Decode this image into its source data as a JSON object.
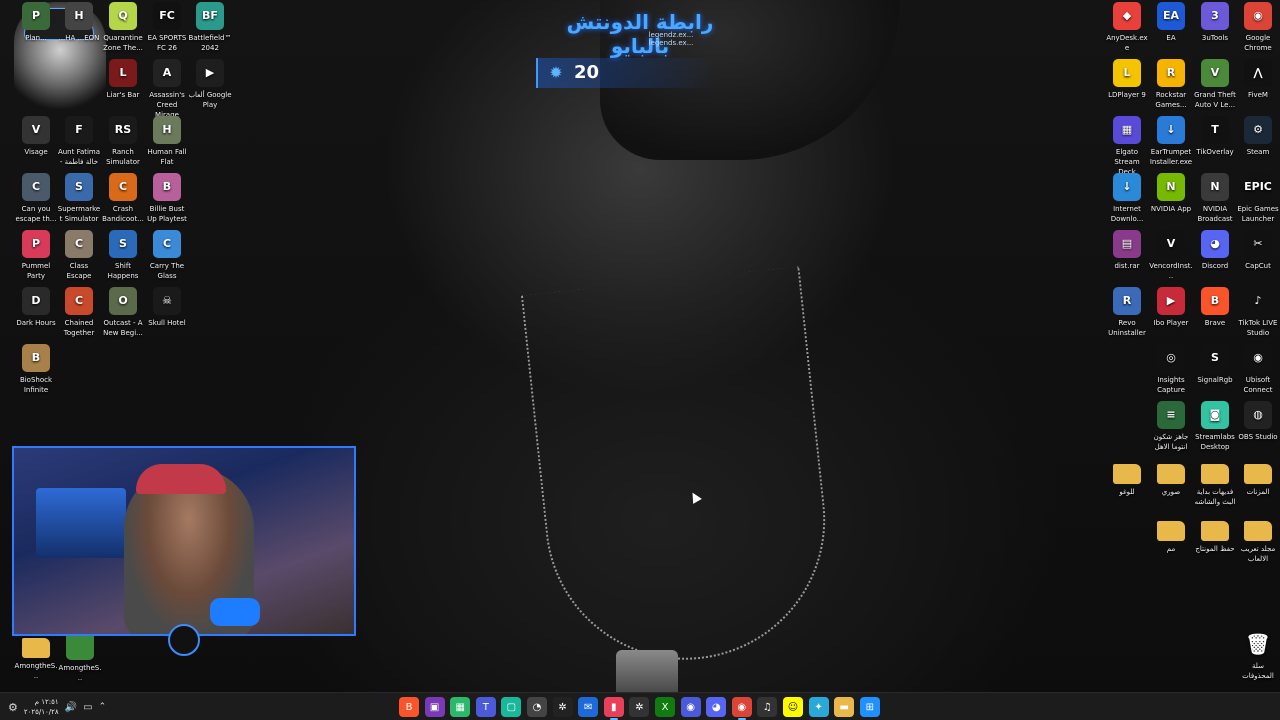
{
  "overlay": {
    "title": "رابطة الدونتش بالبايو",
    "subtitle": "legendz.ex... legends.ex...",
    "counter": "20",
    "counter_icon": "flame-icon"
  },
  "desktop_left": [
    {
      "label": "Plan...",
      "icon": "game-icon",
      "color": "#3a6a3a",
      "glyph": "P"
    },
    {
      "label": "...HA ...EON",
      "icon": "game-icon",
      "color": "#444",
      "glyph": "H"
    },
    {
      "label": "Quarantine Zone The...",
      "icon": "game-icon",
      "color": "#b6d64a",
      "glyph": "Q"
    },
    {
      "label": "EA SPORTS FC 26",
      "icon": "game-icon",
      "color": "#111",
      "glyph": "FC"
    },
    {
      "label": "Battlefield™ 2042",
      "icon": "game-icon",
      "color": "#2a9a8a",
      "glyph": "BF"
    },
    {
      "label": "Liar's Bar",
      "icon": "game-icon",
      "color": "#7a1a1a",
      "glyph": "L"
    },
    {
      "label": "Assassin's Creed Mirage",
      "icon": "game-icon",
      "color": "#222",
      "glyph": "A"
    },
    {
      "label": "ألعاب Google Play",
      "icon": "google-play-icon",
      "color": "#1e1e1e",
      "glyph": "▶"
    },
    {
      "label": "Visage",
      "icon": "game-icon",
      "color": "#333",
      "glyph": "V"
    },
    {
      "label": "Aunt Fatima - خالة فاطمة",
      "icon": "game-icon",
      "color": "#1a1a1a",
      "glyph": "F"
    },
    {
      "label": "Ranch Simulator",
      "icon": "game-icon",
      "color": "#1a1a1a",
      "glyph": "RS"
    },
    {
      "label": "Human Fall Flat",
      "icon": "game-icon",
      "color": "#6a7a5a",
      "glyph": "H"
    },
    {
      "label": "Can you escape th...",
      "icon": "game-icon",
      "color": "#4a5a6a",
      "glyph": "C"
    },
    {
      "label": "Supermarket Simulator",
      "icon": "game-icon",
      "color": "#3a6aaa",
      "glyph": "S"
    },
    {
      "label": "Crash Bandicoot...",
      "icon": "game-icon",
      "color": "#d86a1a",
      "glyph": "C"
    },
    {
      "label": "Billie Bust Up Playtest",
      "icon": "game-icon",
      "color": "#b8609a",
      "glyph": "B"
    },
    {
      "label": "Pummel Party",
      "icon": "game-icon",
      "color": "#d83a5a",
      "glyph": "P"
    },
    {
      "label": "Class Escape",
      "icon": "game-icon",
      "color": "#8a7a6a",
      "glyph": "C"
    },
    {
      "label": "Shift Happens",
      "icon": "game-icon",
      "color": "#2a6ab8",
      "glyph": "S"
    },
    {
      "label": "Carry The Glass",
      "icon": "game-icon",
      "color": "#3a8ad8",
      "glyph": "C"
    },
    {
      "label": "Dark Hours",
      "icon": "game-icon",
      "color": "#2a2a2a",
      "glyph": "D"
    },
    {
      "label": "Chained Together",
      "icon": "game-icon",
      "color": "#c84a2a",
      "glyph": "C"
    },
    {
      "label": "Outcast - A New Begi...",
      "icon": "game-icon",
      "color": "#5a6a4a",
      "glyph": "O"
    },
    {
      "label": "Skull Hotel",
      "icon": "game-icon",
      "color": "#1a1a1a",
      "glyph": "☠"
    },
    {
      "label": "BioShock Infinite",
      "icon": "game-icon",
      "color": "#a8804a",
      "glyph": "B"
    }
  ],
  "desktop_right": [
    {
      "label": "AnyDesk.exe",
      "icon": "anydesk-icon",
      "color": "#e8403a",
      "glyph": "◆"
    },
    {
      "label": "EA",
      "icon": "ea-icon",
      "color": "#1e5ad8",
      "glyph": "EA"
    },
    {
      "label": "3uTools",
      "icon": "3utools-icon",
      "color": "#6a5ad8",
      "glyph": "3"
    },
    {
      "label": "Google Chrome",
      "icon": "chrome-icon",
      "color": "#db4437",
      "glyph": "◉"
    },
    {
      "label": "LDPlayer 9",
      "icon": "ldplayer-icon",
      "color": "#f4c400",
      "glyph": "L"
    },
    {
      "label": "Rockstar Games...",
      "icon": "rockstar-icon",
      "color": "#f4b400",
      "glyph": "R"
    },
    {
      "label": "Grand Theft Auto V Le...",
      "icon": "gta-icon",
      "color": "#4a8a3a",
      "glyph": "V"
    },
    {
      "label": "FiveM",
      "icon": "fivem-icon",
      "color": "#111",
      "glyph": "⋀"
    },
    {
      "label": "Elgato Stream Deck",
      "icon": "streamdeck-icon",
      "color": "#5a4ad8",
      "glyph": "▦"
    },
    {
      "label": "EarTrumpet Installer.exe",
      "icon": "installer-icon",
      "color": "#2a7ad8",
      "glyph": "↓"
    },
    {
      "label": "TikOverlay",
      "icon": "tikoverlay-icon",
      "color": "#111",
      "glyph": "T"
    },
    {
      "label": "Steam",
      "icon": "steam-icon",
      "color": "#1b2838",
      "glyph": "⚙"
    },
    {
      "label": "Internet Downlo...",
      "icon": "idm-icon",
      "color": "#2a8ad8",
      "glyph": "↓"
    },
    {
      "label": "NVIDIA App",
      "icon": "nvidia-icon",
      "color": "#76b900",
      "glyph": "N"
    },
    {
      "label": "NVIDIA Broadcast",
      "icon": "nvidia-broadcast-icon",
      "color": "#3a3a3a",
      "glyph": "N"
    },
    {
      "label": "Epic Games Launcher",
      "icon": "epic-icon",
      "color": "#111",
      "glyph": "EPIC"
    },
    {
      "label": "dist.rar",
      "icon": "winrar-icon",
      "color": "#8a3a8a",
      "glyph": "▤"
    },
    {
      "label": "VencordInst...",
      "icon": "vencord-icon",
      "color": "#111",
      "glyph": "V"
    },
    {
      "label": "Discord",
      "icon": "discord-icon",
      "color": "#5865f2",
      "glyph": "◕"
    },
    {
      "label": "CapCut",
      "icon": "capcut-icon",
      "color": "#111",
      "glyph": "✂"
    },
    {
      "label": "Revo Uninstaller",
      "icon": "revo-icon",
      "color": "#3a6ab8",
      "glyph": "R"
    },
    {
      "label": "Ibo Player",
      "icon": "iboplayer-icon",
      "color": "#c82a3a",
      "glyph": "▶"
    },
    {
      "label": "Brave",
      "icon": "brave-icon",
      "color": "#fb542b",
      "glyph": "B"
    },
    {
      "label": "TikTok LIVE Studio",
      "icon": "tiktok-icon",
      "color": "#111",
      "glyph": "♪"
    },
    {
      "label": "Insights Capture",
      "icon": "insights-icon",
      "color": "#111",
      "glyph": "◎"
    },
    {
      "label": "SignalRgb",
      "icon": "signalrgb-icon",
      "color": "#111",
      "glyph": "S"
    },
    {
      "label": "Ubisoft Connect",
      "icon": "ubisoft-icon",
      "color": "#111",
      "glyph": "◉"
    },
    {
      "label": "جاهز شكون انتوما الاهل",
      "icon": "file-icon",
      "color": "#2a6a3a",
      "glyph": "≡"
    },
    {
      "label": "Streamlabs Desktop",
      "icon": "streamlabs-icon",
      "color": "#31c3a2",
      "glyph": "◙"
    },
    {
      "label": "OBS Studio",
      "icon": "obs-icon",
      "color": "#222",
      "glyph": "◍"
    },
    {
      "label": "للوغو",
      "icon": "folder-icon",
      "color": "#e8b84a",
      "glyph": ""
    },
    {
      "label": "صوري",
      "icon": "folder-icon",
      "color": "#e8b84a",
      "glyph": ""
    },
    {
      "label": "فديهات بداية البث والشاشه",
      "icon": "folder-icon",
      "color": "#e8b84a",
      "glyph": ""
    },
    {
      "label": "المزنات",
      "icon": "folder-icon",
      "color": "#e8b84a",
      "glyph": ""
    },
    {
      "label": "مم",
      "icon": "folder-icon",
      "color": "#e8b84a",
      "glyph": ""
    },
    {
      "label": "حفظ المونتاج",
      "icon": "folder-icon",
      "color": "#e8b84a",
      "glyph": ""
    },
    {
      "label": "مجلد تعريب الالعاب",
      "icon": "folder-icon",
      "color": "#e8b84a",
      "glyph": ""
    }
  ],
  "recycle_bin": {
    "label": "سلة المحذوفات",
    "icon": "recycle-bin-icon"
  },
  "desktop_bottom": [
    {
      "label": "AmongtheS...",
      "icon": "folder-icon",
      "color": "#e8b84a"
    },
    {
      "label": "AmongtheS...",
      "icon": "game-icon",
      "color": "#3a8a3a"
    }
  ],
  "taskbar": {
    "apps": [
      {
        "name": "brave",
        "icon": "brave-icon",
        "color": "#fb542b",
        "glyph": "B"
      },
      {
        "name": "app-purple",
        "icon": "app-icon",
        "color": "#7a3ab8",
        "glyph": "▣"
      },
      {
        "name": "app-green",
        "icon": "app-icon",
        "color": "#2ab86a",
        "glyph": "▦"
      },
      {
        "name": "teams",
        "icon": "teams-icon",
        "color": "#4a5ad8",
        "glyph": "T"
      },
      {
        "name": "app-teal",
        "icon": "app-icon",
        "color": "#1ab89a",
        "glyph": "▢"
      },
      {
        "name": "app-spinner",
        "icon": "app-icon",
        "color": "#444",
        "glyph": "◔"
      },
      {
        "name": "chatgpt",
        "icon": "chatgpt-icon",
        "color": "#222",
        "glyph": "✲"
      },
      {
        "name": "outlook",
        "icon": "mail-icon",
        "color": "#1e6ad8",
        "glyph": "✉"
      },
      {
        "name": "document",
        "icon": "document-icon",
        "color": "#e8405a",
        "glyph": "▮",
        "active": true
      },
      {
        "name": "openai",
        "icon": "openai-icon",
        "color": "#333",
        "glyph": "✲"
      },
      {
        "name": "xbox",
        "icon": "xbox-icon",
        "color": "#107c10",
        "glyph": "X"
      },
      {
        "name": "app-blue",
        "icon": "app-icon",
        "color": "#4a5ad8",
        "glyph": "◉"
      },
      {
        "name": "discord",
        "icon": "discord-icon",
        "color": "#5865f2",
        "glyph": "◕"
      },
      {
        "name": "chrome",
        "icon": "chrome-icon",
        "color": "#db4437",
        "glyph": "◉",
        "active": true
      },
      {
        "name": "music",
        "icon": "music-icon",
        "color": "#333",
        "glyph": "♫"
      },
      {
        "name": "snapchat",
        "icon": "snapchat-icon",
        "color": "#fffc00",
        "glyph": "☺"
      },
      {
        "name": "app-multi",
        "icon": "app-icon",
        "color": "#2aa8d8",
        "glyph": "✦"
      },
      {
        "name": "file-explorer",
        "icon": "folder-icon",
        "color": "#e8b84a",
        "glyph": "▬"
      },
      {
        "name": "start",
        "icon": "windows-icon",
        "color": "#1e90ff",
        "glyph": "⊞"
      }
    ],
    "clock_time": "١٢:٥١ م",
    "clock_date": "٢٠٢٥/١٠/٢٨"
  }
}
